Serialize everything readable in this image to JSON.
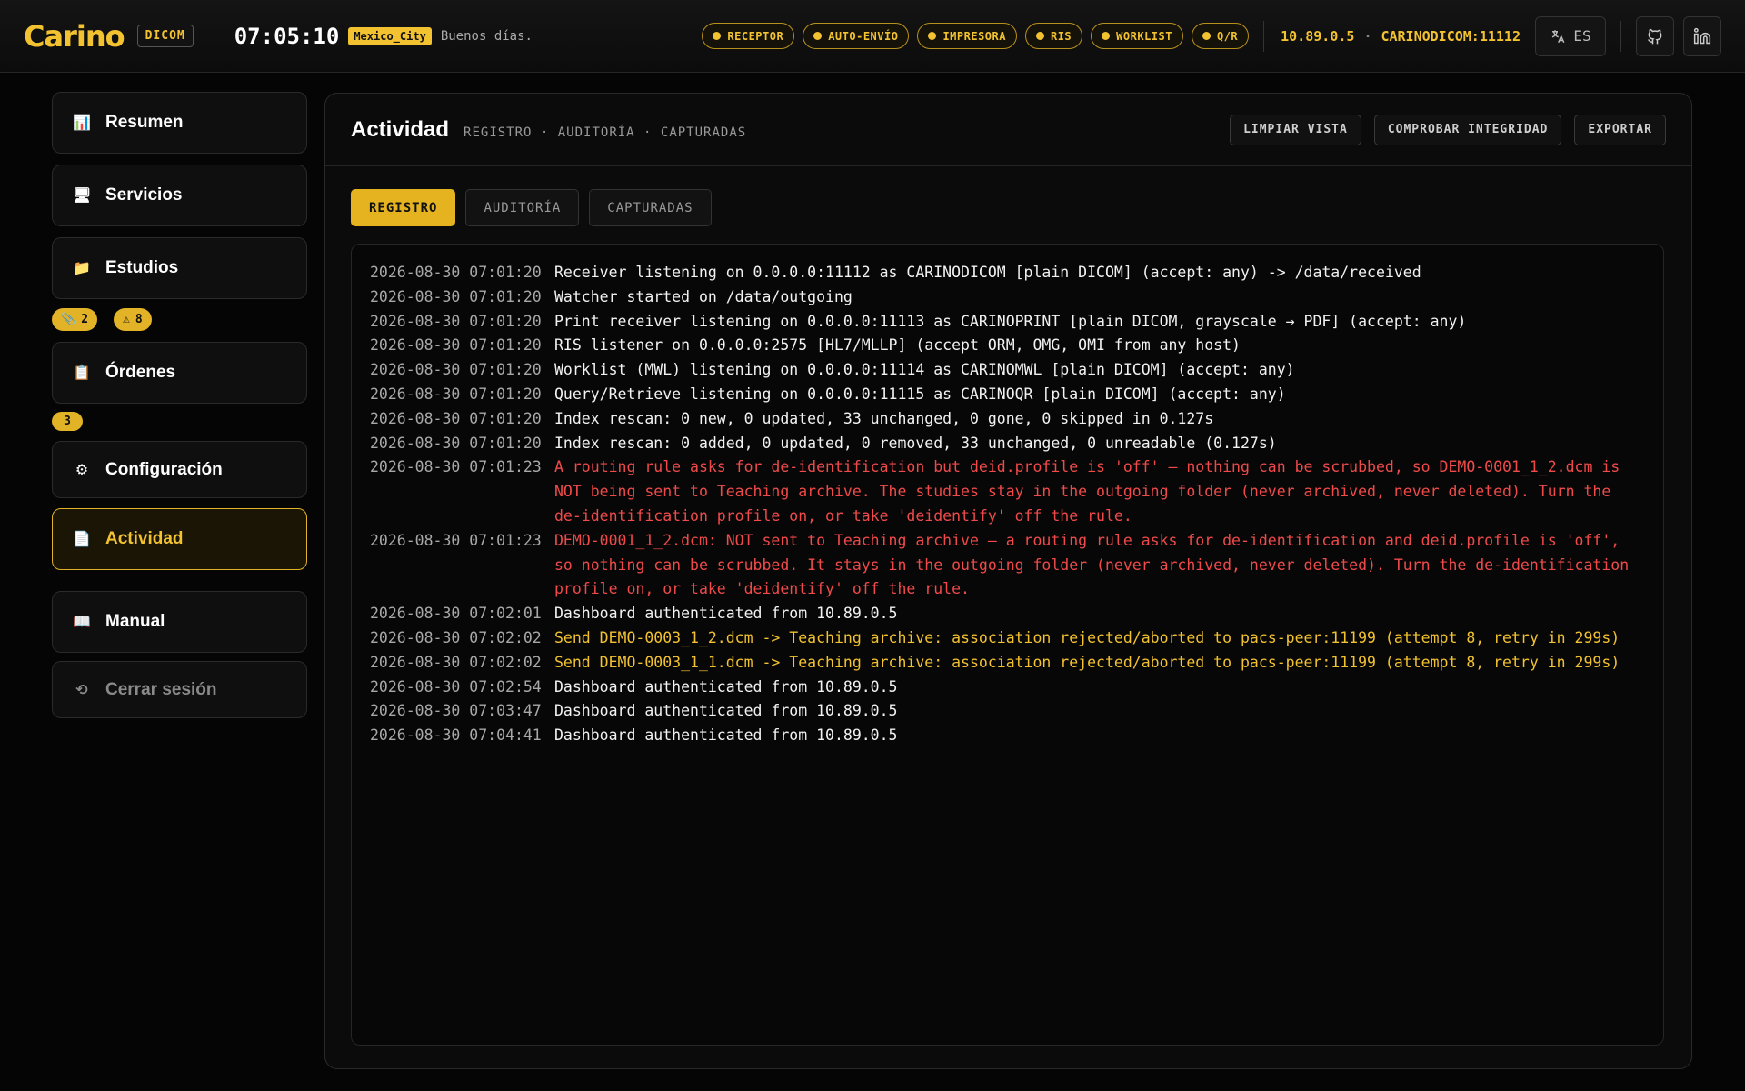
{
  "header": {
    "logo": "Carino",
    "product_badge": "DICOM",
    "clock": "07:05:10",
    "timezone": "Mexico_City",
    "greeting": "Buenos días.",
    "services": [
      "RECEPTOR",
      "AUTO-ENVÍO",
      "IMPRESORA",
      "RIS",
      "WORKLIST",
      "Q/R"
    ],
    "host_ip": "10.89.0.5",
    "host_sep": "·",
    "host_ae": "CARINODICOM:11112",
    "language": "ES"
  },
  "sidebar": {
    "items": [
      {
        "label": "Resumen",
        "icon": "bar-chart-icon"
      },
      {
        "label": "Servicios",
        "icon": "monitor-icon"
      },
      {
        "label": "Estudios",
        "icon": "folder-icon"
      },
      {
        "label": "Órdenes",
        "icon": "clipboard-icon"
      },
      {
        "label": "Configuración",
        "icon": "gear-icon"
      },
      {
        "label": "Actividad",
        "icon": "document-icon"
      },
      {
        "label": "Manual",
        "icon": "book-icon"
      },
      {
        "label": "Cerrar sesión",
        "icon": "logout-icon"
      }
    ],
    "studies_badges": {
      "attachments": "2",
      "warnings": "8"
    },
    "orders_badge": "3",
    "active": "Actividad"
  },
  "panel": {
    "title": "Actividad",
    "subtitle": "REGISTRO · AUDITORÍA · CAPTURADAS",
    "actions": [
      "LIMPIAR VISTA",
      "COMPROBAR INTEGRIDAD",
      "EXPORTAR"
    ],
    "tabs": [
      "REGISTRO",
      "AUDITORÍA",
      "CAPTURADAS"
    ],
    "active_tab": "REGISTRO"
  },
  "log": [
    {
      "ts": "2026-08-30 07:01:20",
      "level": "info",
      "msg": "Receiver listening on 0.0.0.0:11112 as CARINODICOM [plain DICOM] (accept: any) -> /data/received"
    },
    {
      "ts": "2026-08-30 07:01:20",
      "level": "info",
      "msg": "Watcher started on /data/outgoing"
    },
    {
      "ts": "2026-08-30 07:01:20",
      "level": "info",
      "msg": "Print receiver listening on 0.0.0.0:11113 as CARINOPRINT [plain DICOM, grayscale → PDF] (accept: any)"
    },
    {
      "ts": "2026-08-30 07:01:20",
      "level": "info",
      "msg": "RIS listener on 0.0.0.0:2575 [HL7/MLLP] (accept ORM, OMG, OMI from any host)"
    },
    {
      "ts": "2026-08-30 07:01:20",
      "level": "info",
      "msg": "Worklist (MWL) listening on 0.0.0.0:11114 as CARINOMWL [plain DICOM] (accept: any)"
    },
    {
      "ts": "2026-08-30 07:01:20",
      "level": "info",
      "msg": "Query/Retrieve listening on 0.0.0.0:11115 as CARINOQR [plain DICOM] (accept: any)"
    },
    {
      "ts": "2026-08-30 07:01:20",
      "level": "info",
      "msg": "Index rescan: 0 new, 0 updated, 33 unchanged, 0 gone, 0 skipped in 0.127s"
    },
    {
      "ts": "2026-08-30 07:01:20",
      "level": "info",
      "msg": "Index rescan: 0 added, 0 updated, 0 removed, 33 unchanged, 0 unreadable (0.127s)"
    },
    {
      "ts": "2026-08-30 07:01:23",
      "level": "error",
      "msg": "A routing rule asks for de-identification but deid.profile is 'off' — nothing can be scrubbed, so DEMO-0001_1_2.dcm is NOT being sent to Teaching archive. The studies stay in the outgoing folder (never archived, never deleted). Turn the de-identification profile on, or take 'deidentify' off the rule."
    },
    {
      "ts": "2026-08-30 07:01:23",
      "level": "error",
      "msg": "DEMO-0001_1_2.dcm: NOT sent to Teaching archive — a routing rule asks for de-identification and deid.profile is 'off', so nothing can be scrubbed. It stays in the outgoing folder (never archived, never deleted). Turn the de-identification profile on, or take 'deidentify' off the rule."
    },
    {
      "ts": "2026-08-30 07:02:01",
      "level": "info",
      "msg": "Dashboard authenticated from 10.89.0.5"
    },
    {
      "ts": "2026-08-30 07:02:02",
      "level": "warn",
      "msg": "Send DEMO-0003_1_2.dcm -> Teaching archive: association rejected/aborted to pacs-peer:11199 (attempt 8, retry in 299s)"
    },
    {
      "ts": "2026-08-30 07:02:02",
      "level": "warn",
      "msg": "Send DEMO-0003_1_1.dcm -> Teaching archive: association rejected/aborted to pacs-peer:11199 (attempt 8, retry in 299s)"
    },
    {
      "ts": "2026-08-30 07:02:54",
      "level": "info",
      "msg": "Dashboard authenticated from 10.89.0.5"
    },
    {
      "ts": "2026-08-30 07:03:47",
      "level": "info",
      "msg": "Dashboard authenticated from 10.89.0.5"
    },
    {
      "ts": "2026-08-30 07:04:41",
      "level": "info",
      "msg": "Dashboard authenticated from 10.89.0.5"
    }
  ],
  "colors": {
    "accent": "#f2c230",
    "error": "#f04a4a",
    "background": "#050505"
  }
}
